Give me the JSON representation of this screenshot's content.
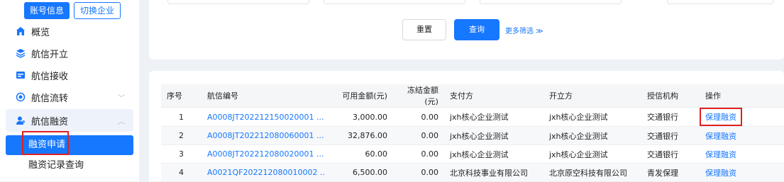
{
  "sidebar": {
    "account_info": "账号信息",
    "switch_company": "切换企业",
    "menu": [
      {
        "label": "概览",
        "icon": "home-icon"
      },
      {
        "label": "航信开立",
        "icon": "layers-icon"
      },
      {
        "label": "航信接收",
        "icon": "receive-icon"
      },
      {
        "label": "航信流转",
        "icon": "transfer-icon"
      },
      {
        "label": "航信融资",
        "icon": "finance-icon"
      }
    ],
    "submenu": [
      {
        "label": "融资申请"
      },
      {
        "label": "融资记录查询"
      }
    ]
  },
  "filters": {
    "reset": "重置",
    "query": "查询",
    "more": "更多筛选 ≫"
  },
  "table": {
    "columns": [
      "序号",
      "航信编号",
      "可用金额(元)",
      "冻结金额(元)",
      "支付方",
      "开立方",
      "授信机构",
      "操作"
    ],
    "rows": [
      {
        "idx": "1",
        "code": "A0008JT202212150020001 ...",
        "available": "3,000.00",
        "frozen": "0.00",
        "payer": "jxh核心企业测试",
        "issuer": "jxh核心企业测试",
        "org": "交通银行",
        "action": "保理融资"
      },
      {
        "idx": "2",
        "code": "A0008JT202212080060001 ...",
        "available": "32,876.00",
        "frozen": "0.00",
        "payer": "jxh核心企业测试",
        "issuer": "jxh核心企业测试",
        "org": "交通银行",
        "action": "保理融资"
      },
      {
        "idx": "3",
        "code": "A0008JT202212080020001 ...",
        "available": "60.00",
        "frozen": "0.00",
        "payer": "jxh核心企业测试",
        "issuer": "jxh核心企业测试",
        "org": "交通银行",
        "action": "保理融资"
      },
      {
        "idx": "4",
        "code": "A0021QF202212080010002 ..",
        "available": "6,500.00",
        "frozen": "0.00",
        "payer": "北京科技事业有限公司",
        "issuer": "北京原空科技有限公司",
        "org": "青发保理",
        "action": "保理融资"
      }
    ]
  },
  "colors": {
    "primary": "#1677ff",
    "highlight": "#e02020"
  }
}
